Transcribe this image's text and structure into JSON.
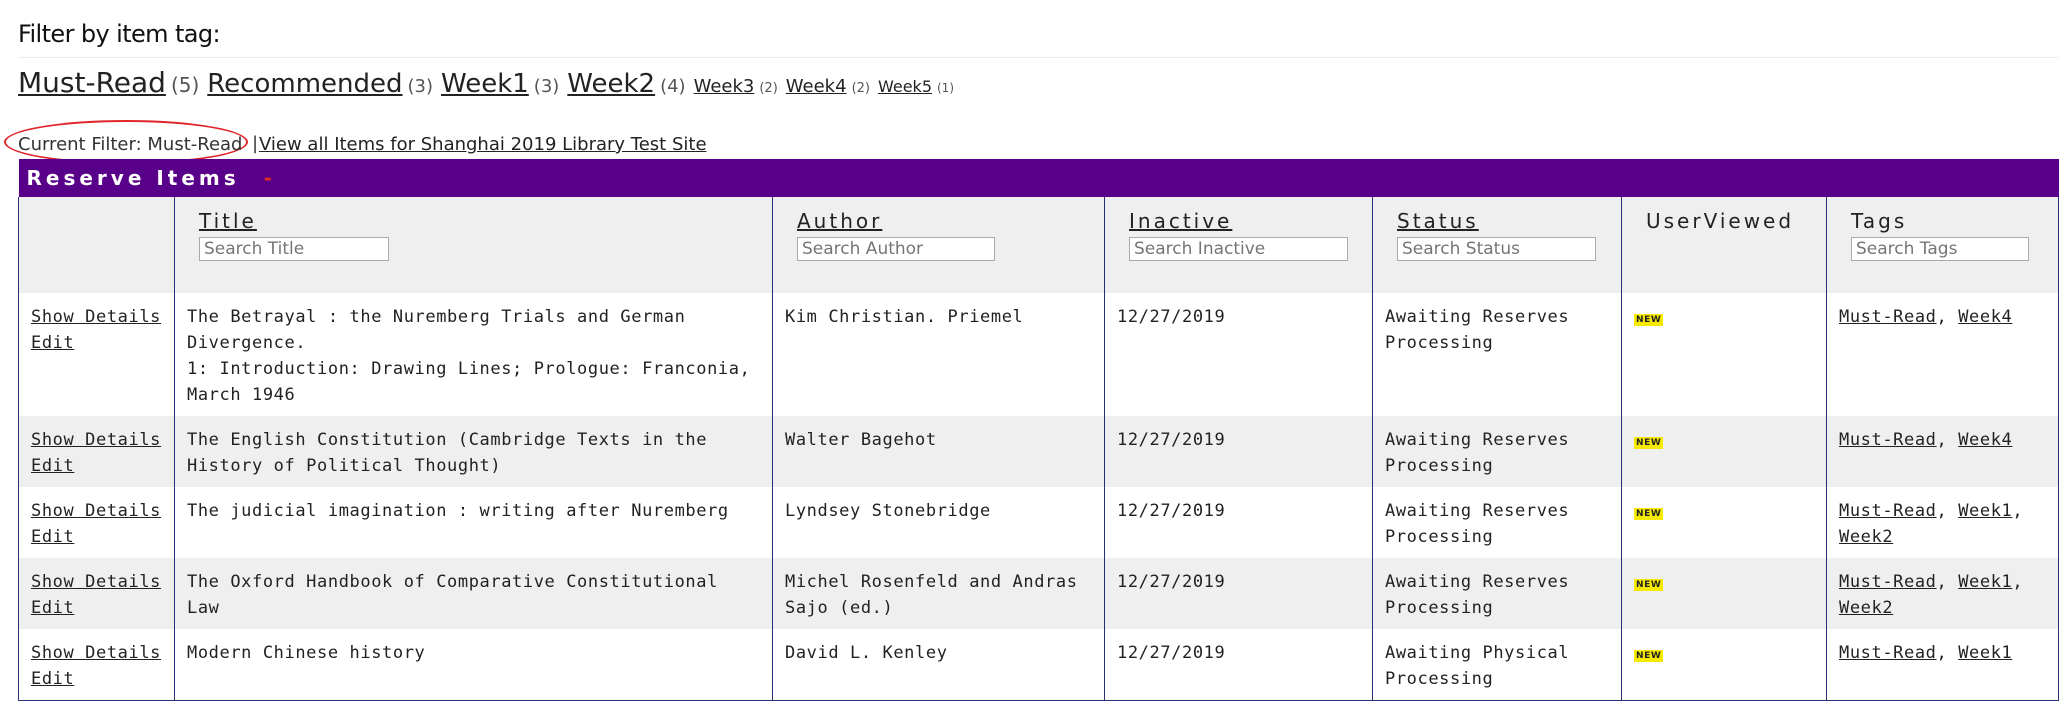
{
  "filter_section": {
    "heading": "Filter by item tag:",
    "tags": [
      {
        "label": "Must-Read",
        "count": "(5)"
      },
      {
        "label": "Recommended",
        "count": "(3)"
      },
      {
        "label": "Week1",
        "count": "(3)"
      },
      {
        "label": "Week2",
        "count": "(4)"
      },
      {
        "label": "Week3",
        "count": "(2)"
      },
      {
        "label": "Week4",
        "count": "(2)"
      },
      {
        "label": "Week5",
        "count": "(1)"
      }
    ],
    "current_filter": "Current Filter: Must-Read",
    "separator": "|",
    "view_all": "View all Items for Shanghai 2019 Library Test Site"
  },
  "table": {
    "caption": "Reserve Items",
    "caption_mark": "-",
    "headers": {
      "title": "Title",
      "author": "Author",
      "inactive": "Inactive",
      "status": "Status",
      "userviewed": "UserViewed",
      "tags": "Tags"
    },
    "placeholders": {
      "title": "Search Title",
      "author": "Search Author",
      "inactive": "Search Inactive",
      "status": "Search Status",
      "tags": "Search Tags"
    },
    "action_labels": {
      "details": "Show Details",
      "edit": "Edit"
    },
    "new_badge": "NEW",
    "rows": [
      {
        "title": "The Betrayal : the Nuremberg Trials and German Divergence.",
        "subtitle": "1: Introduction: Drawing Lines; Prologue: Franconia, March 1946",
        "author": "Kim Christian. Priemel",
        "inactive": "12/27/2019",
        "status": "Awaiting Reserves Processing",
        "tags": [
          "Must-Read",
          "Week4"
        ]
      },
      {
        "title": "The English Constitution (Cambridge Texts in the History of Political Thought)",
        "subtitle": "",
        "author": "Walter Bagehot",
        "inactive": "12/27/2019",
        "status": "Awaiting Reserves Processing",
        "tags": [
          "Must-Read",
          "Week4"
        ]
      },
      {
        "title": "The judicial imagination : writing after Nuremberg",
        "subtitle": "",
        "author": "Lyndsey Stonebridge",
        "inactive": "12/27/2019",
        "status": "Awaiting Reserves Processing",
        "tags": [
          "Must-Read",
          "Week1",
          "Week2"
        ]
      },
      {
        "title": "The Oxford Handbook of Comparative Constitutional Law",
        "subtitle": "",
        "author": "Michel Rosenfeld and Andras Sajo (ed.)",
        "inactive": "12/27/2019",
        "status": "Awaiting Reserves Processing",
        "tags": [
          "Must-Read",
          "Week1",
          "Week2"
        ]
      },
      {
        "title": "Modern Chinese history",
        "subtitle": "",
        "author": "David L. Kenley",
        "inactive": "12/27/2019",
        "status": "Awaiting Physical Processing",
        "tags": [
          "Must-Read",
          "Week1"
        ]
      }
    ]
  },
  "colors": {
    "caption_bg": "#58008a",
    "annotation_circle": "#e0262b",
    "new_badge_bg": "#f5ea00",
    "border": "#2a2f7a"
  }
}
